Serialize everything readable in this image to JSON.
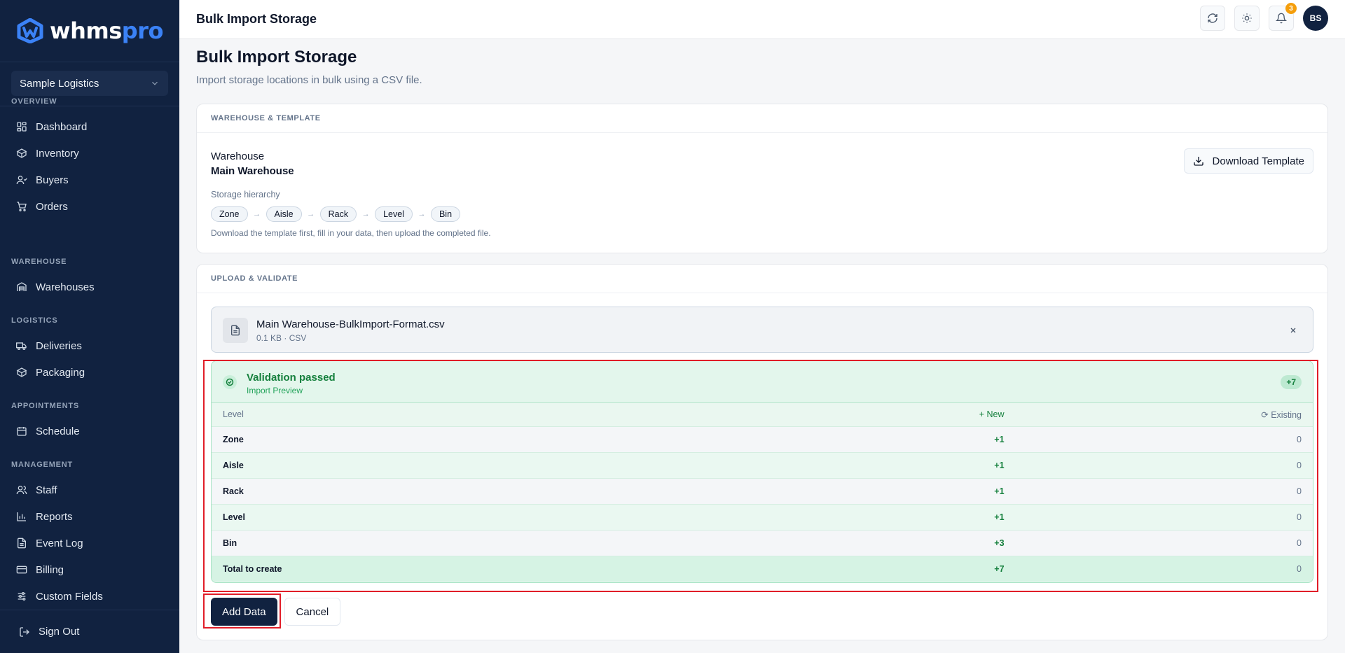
{
  "brand": {
    "word_main": "whms",
    "word_accent": "pro",
    "accent_color": "#3b82f6",
    "sidebar_bg": "#112240"
  },
  "org_selector": {
    "value": "Sample Logistics"
  },
  "nav": {
    "overview": {
      "label": "OVERVIEW",
      "items": [
        {
          "label": "Dashboard",
          "icon": "dashboard-icon"
        },
        {
          "label": "Inventory",
          "icon": "box-icon"
        },
        {
          "label": "Buyers",
          "icon": "user-icon"
        },
        {
          "label": "Orders",
          "icon": "cart-icon"
        }
      ]
    },
    "warehouse": {
      "label": "WAREHOUSE",
      "items": [
        {
          "label": "Warehouses",
          "icon": "warehouse-icon"
        }
      ]
    },
    "logistics": {
      "label": "LOGISTICS",
      "items": [
        {
          "label": "Deliveries",
          "icon": "truck-icon"
        },
        {
          "label": "Packaging",
          "icon": "package-icon"
        }
      ]
    },
    "appointments": {
      "label": "APPOINTMENTS",
      "items": [
        {
          "label": "Schedule",
          "icon": "calendar-icon"
        }
      ]
    },
    "management": {
      "label": "MANAGEMENT",
      "items": [
        {
          "label": "Staff",
          "icon": "users-icon"
        },
        {
          "label": "Reports",
          "icon": "chart-icon"
        },
        {
          "label": "Event Log",
          "icon": "file-icon"
        },
        {
          "label": "Billing",
          "icon": "card-icon"
        },
        {
          "label": "Custom Fields",
          "icon": "sliders-icon"
        }
      ]
    },
    "sign_out": "Sign Out"
  },
  "topbar": {
    "title": "Bulk Import Storage",
    "notification_count": "3",
    "avatar_initials": "BS"
  },
  "page": {
    "title": "Bulk Import Storage",
    "subtitle": "Import storage locations in bulk using a CSV file."
  },
  "warehouse_card": {
    "heading": "WAREHOUSE & TEMPLATE",
    "warehouse_label": "Warehouse",
    "warehouse_value": "Main Warehouse",
    "download_label": "Download Template",
    "hierarchy_label": "Storage hierarchy",
    "hierarchy": [
      "Zone",
      "Aisle",
      "Rack",
      "Level",
      "Bin"
    ],
    "hint": "Download the template first, fill in your data, then upload the completed file."
  },
  "upload_card": {
    "heading": "UPLOAD & VALIDATE",
    "file_name": "Main Warehouse-BulkImport-Format.csv",
    "file_meta": "0.1 KB · CSV",
    "validation": {
      "title": "Validation passed",
      "subtitle": "Import Preview",
      "badge": "+7",
      "columns": {
        "level": "Level",
        "new": "New",
        "existing": "Existing"
      },
      "rows": [
        {
          "level": "Zone",
          "new": "+1",
          "existing": "0"
        },
        {
          "level": "Aisle",
          "new": "+1",
          "existing": "0"
        },
        {
          "level": "Rack",
          "new": "+1",
          "existing": "0"
        },
        {
          "level": "Level",
          "new": "+1",
          "existing": "0"
        },
        {
          "level": "Bin",
          "new": "+3",
          "existing": "0"
        }
      ],
      "total": {
        "level": "Total to create",
        "new": "+7",
        "existing": "0"
      }
    },
    "add_label": "Add Data",
    "cancel_label": "Cancel"
  }
}
